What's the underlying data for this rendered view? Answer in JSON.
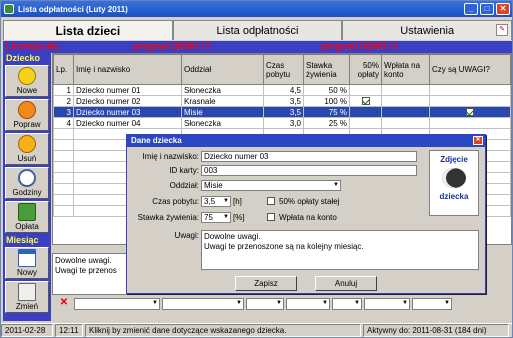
{
  "window": {
    "title": "Lista odpłatności (Luty 2011)"
  },
  "tabs": [
    {
      "label": "Lista dzieci"
    },
    {
      "label": "Lista odpłatności"
    },
    {
      "label": "Ustawienia"
    }
  ],
  "license": {
    "label": "Licencja dla:",
    "demo1": "program DEMO !!!",
    "demo2": "program DEMO !!!"
  },
  "sidebar": {
    "section1": "Dziecko",
    "buttons1": [
      {
        "label": "Nowe",
        "icon": "smile-icon"
      },
      {
        "label": "Popraw",
        "icon": "frown-icon"
      },
      {
        "label": "Usuń",
        "icon": "sad-icon"
      },
      {
        "label": "Godziny",
        "icon": "clock-icon"
      },
      {
        "label": "Opłata",
        "icon": "money-icon"
      }
    ],
    "section2": "Miesiąc",
    "buttons2": [
      {
        "label": "Nowy",
        "icon": "calendar-icon"
      },
      {
        "label": "Zmień",
        "icon": "edit-icon"
      }
    ]
  },
  "table": {
    "headers": [
      "Lp.",
      "Imię i nazwisko",
      "Oddział",
      "Czas pobytu",
      "Stawka żywienia",
      "50% opłaty",
      "Wpłata na konto",
      "Czy są UWAGI?"
    ],
    "rows": [
      {
        "lp": "1",
        "name": "Dziecko numer 01",
        "group": "Słoneczka",
        "time": "4,5",
        "rate": "50 %",
        "half": false,
        "transfer": false,
        "notes": false
      },
      {
        "lp": "2",
        "name": "Dziecko numer 02",
        "group": "Krasnale",
        "time": "3,5",
        "rate": "100 %",
        "half": true,
        "transfer": false,
        "notes": false
      },
      {
        "lp": "3",
        "name": "Dziecko numer 03",
        "group": "Misie",
        "time": "3,5",
        "rate": "75 %",
        "half": false,
        "transfer": false,
        "notes": true
      },
      {
        "lp": "4",
        "name": "Dziecko numer 04",
        "group": "Słoneczka",
        "time": "3,0",
        "rate": "25 %",
        "half": false,
        "transfer": false,
        "notes": false
      }
    ],
    "empty_rows": 8
  },
  "notes_preview": "Dowolne uwagi. Uwagi te przenos",
  "status": {
    "date": "2011-02-28",
    "time": "12:11",
    "hint": "Kliknij by zmienić dane dotyczące wskazanego dziecka.",
    "active": "Aktywny do: 2011-08-31 (184 dni)"
  },
  "dialog": {
    "title": "Dane dziecka",
    "name_label": "Imię i nazwisko:",
    "name_value": "Dziecko numer 03",
    "id_label": "ID karty:",
    "id_value": "003",
    "group_label": "Oddział:",
    "group_value": "Misie",
    "time_label": "Czas pobytu:",
    "time_value": "3,5",
    "time_unit": "[h]",
    "rate_label": "Stawka żywienia:",
    "rate_value": "75",
    "rate_unit": "[%]",
    "half_label": "50% opłaty stałej",
    "transfer_label": "Wpłata na konto",
    "notes_label": "Uwagi:",
    "notes_line1": "Dowolne uwagi.",
    "notes_line2": "Uwagi te przenoszone są na kolejny miesiąc.",
    "photo_line1": "Zdjęcie",
    "photo_line2": "dziecka",
    "save": "Zapisz",
    "cancel": "Anuluj"
  }
}
